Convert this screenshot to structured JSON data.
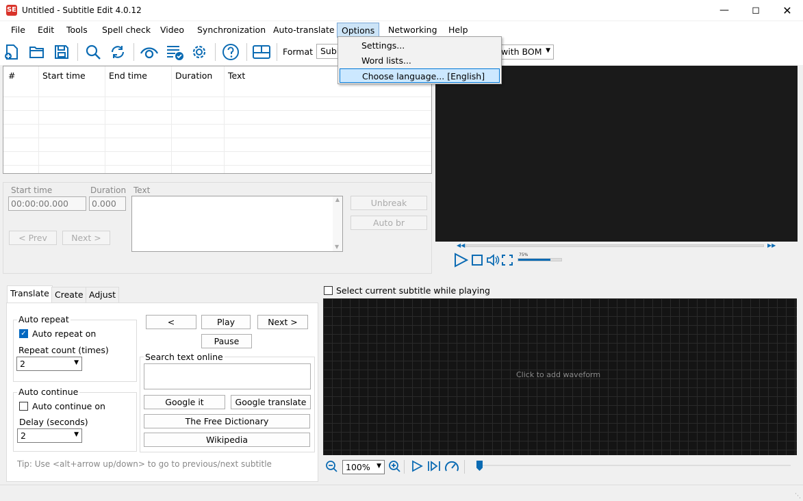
{
  "window": {
    "title": "Untitled - Subtitle Edit 4.0.12",
    "app_icon": "SE"
  },
  "menubar": [
    "File",
    "Edit",
    "Tools",
    "Spell check",
    "Video",
    "Synchronization",
    "Auto-translate",
    "Options",
    "Networking",
    "Help"
  ],
  "options_menu": {
    "items": [
      "Settings...",
      "Word lists...",
      "Choose language... [English]"
    ],
    "highlighted": 2
  },
  "toolbar": {
    "format_label": "Format",
    "format_value": "Subl",
    "encoding_value": "with BOM"
  },
  "grid": {
    "columns": [
      "#",
      "Start time",
      "End time",
      "Duration",
      "Text"
    ]
  },
  "edit": {
    "start_time_label": "Start time",
    "duration_label": "Duration",
    "text_label": "Text",
    "start_time_value": "00:00:00.000",
    "duration_value": "0.000",
    "unbreak": "Unbreak",
    "auto_br": "Auto br",
    "prev": "< Prev",
    "next": "Next >"
  },
  "video": {
    "volume_label": "75%",
    "volume_level": 0.75
  },
  "waveform": {
    "select_label": "Select current subtitle while playing",
    "click_text": "Click to add waveform",
    "zoom": "100%"
  },
  "tabs": [
    "Translate",
    "Create",
    "Adjust"
  ],
  "translate": {
    "auto_repeat_title": "Auto repeat",
    "auto_repeat_on": "Auto repeat on",
    "repeat_count_label": "Repeat count (times)",
    "repeat_count": "2",
    "auto_continue_title": "Auto continue",
    "auto_continue_on": "Auto continue on",
    "delay_label": "Delay (seconds)",
    "delay": "2",
    "prev_btn": "<",
    "play_btn": "Play",
    "next_btn": "Next >",
    "pause_btn": "Pause",
    "search_label": "Search text online",
    "google_it": "Google it",
    "google_translate": "Google translate",
    "free_dictionary": "The Free Dictionary",
    "wikipedia": "Wikipedia",
    "tip": "Tip: Use <alt+arrow up/down> to go to previous/next subtitle"
  },
  "colors": {
    "accent": "#0067c0",
    "highlight": "#cce8ff",
    "video_bg": "#1a1a1a"
  }
}
